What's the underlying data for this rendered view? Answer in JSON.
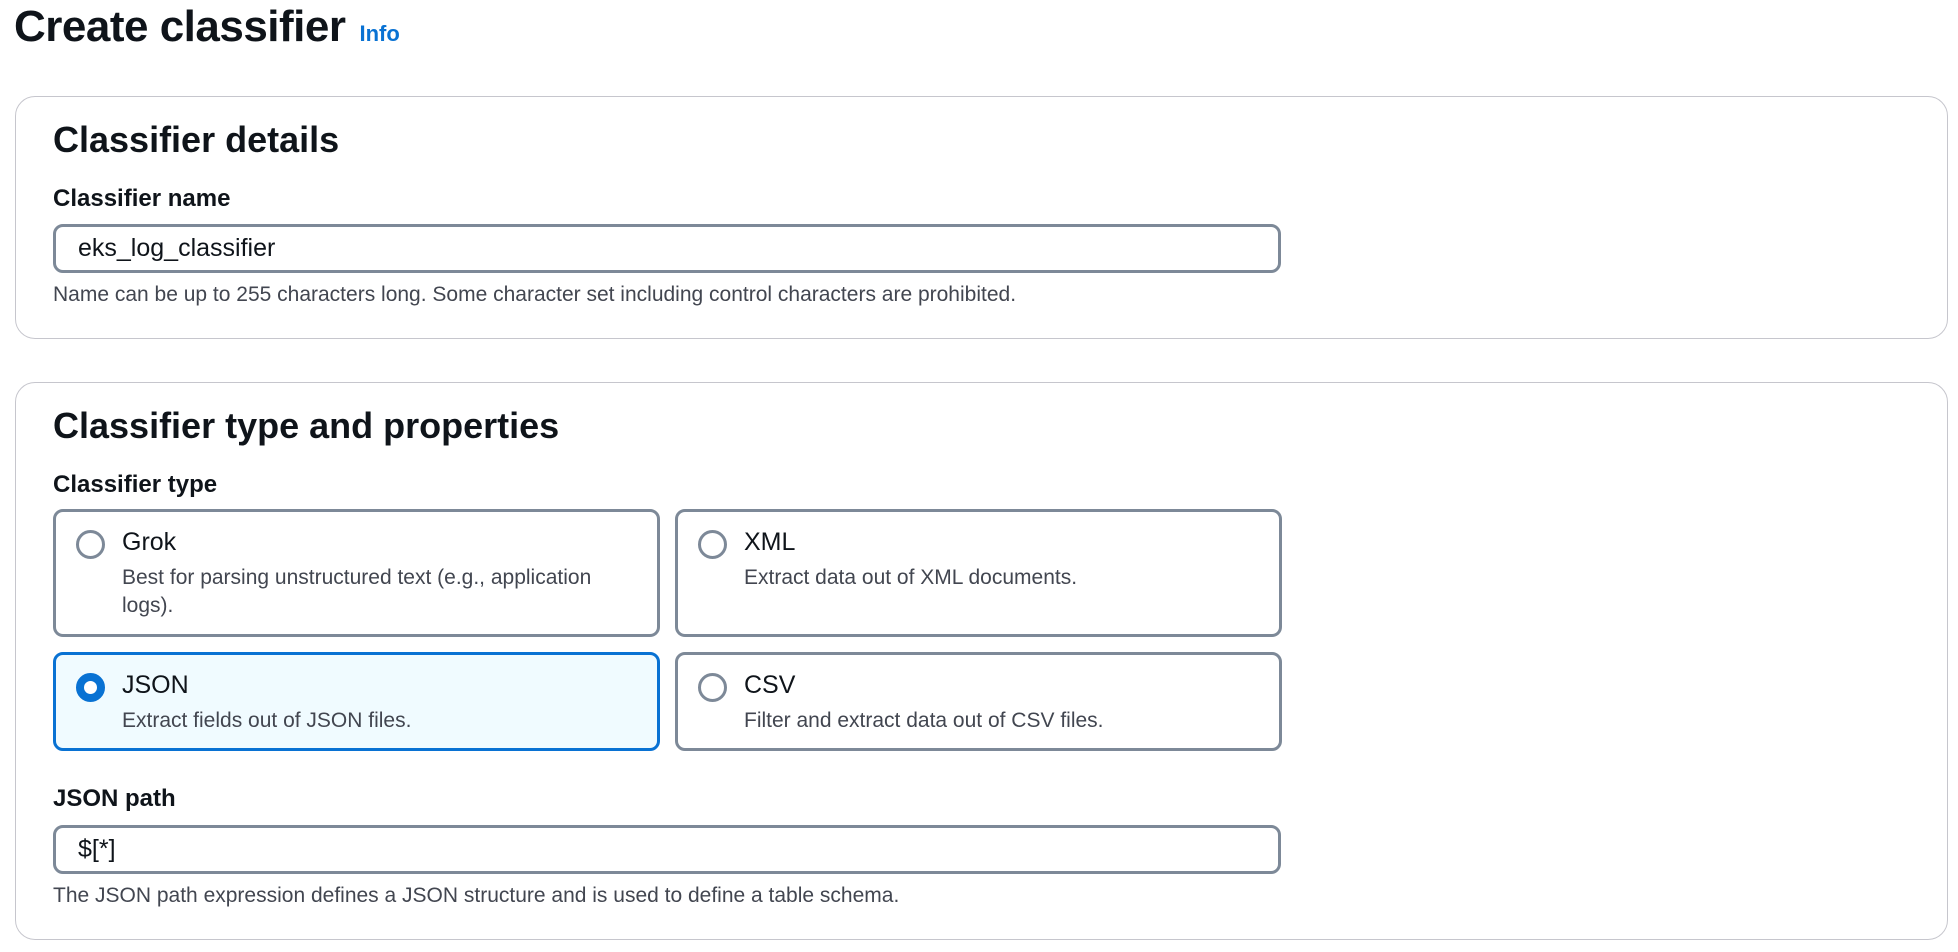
{
  "header": {
    "title": "Create classifier",
    "info_link": "Info"
  },
  "details_panel": {
    "title": "Classifier details",
    "name_label": "Classifier name",
    "name_value": "eks_log_classifier",
    "name_help": "Name can be up to 255 characters long. Some character set including control characters are prohibited."
  },
  "type_panel": {
    "title": "Classifier type and properties",
    "type_label": "Classifier type",
    "selected_type": "JSON",
    "options": [
      {
        "label": "Grok",
        "description": "Best for parsing unstructured text (e.g., application logs)."
      },
      {
        "label": "XML",
        "description": "Extract data out of XML documents."
      },
      {
        "label": "JSON",
        "description": "Extract fields out of JSON files."
      },
      {
        "label": "CSV",
        "description": "Filter and extract data out of CSV files."
      }
    ],
    "json_path_label": "JSON path",
    "json_path_value": "$[*]",
    "json_path_help": "The JSON path expression defines a JSON structure and is used to define a table schema."
  },
  "colors": {
    "accent": "#0972d3",
    "selected_bg": "#f0fbff",
    "border": "#7d8998",
    "panel_border": "#c6c6cd",
    "help_text": "#424650"
  }
}
